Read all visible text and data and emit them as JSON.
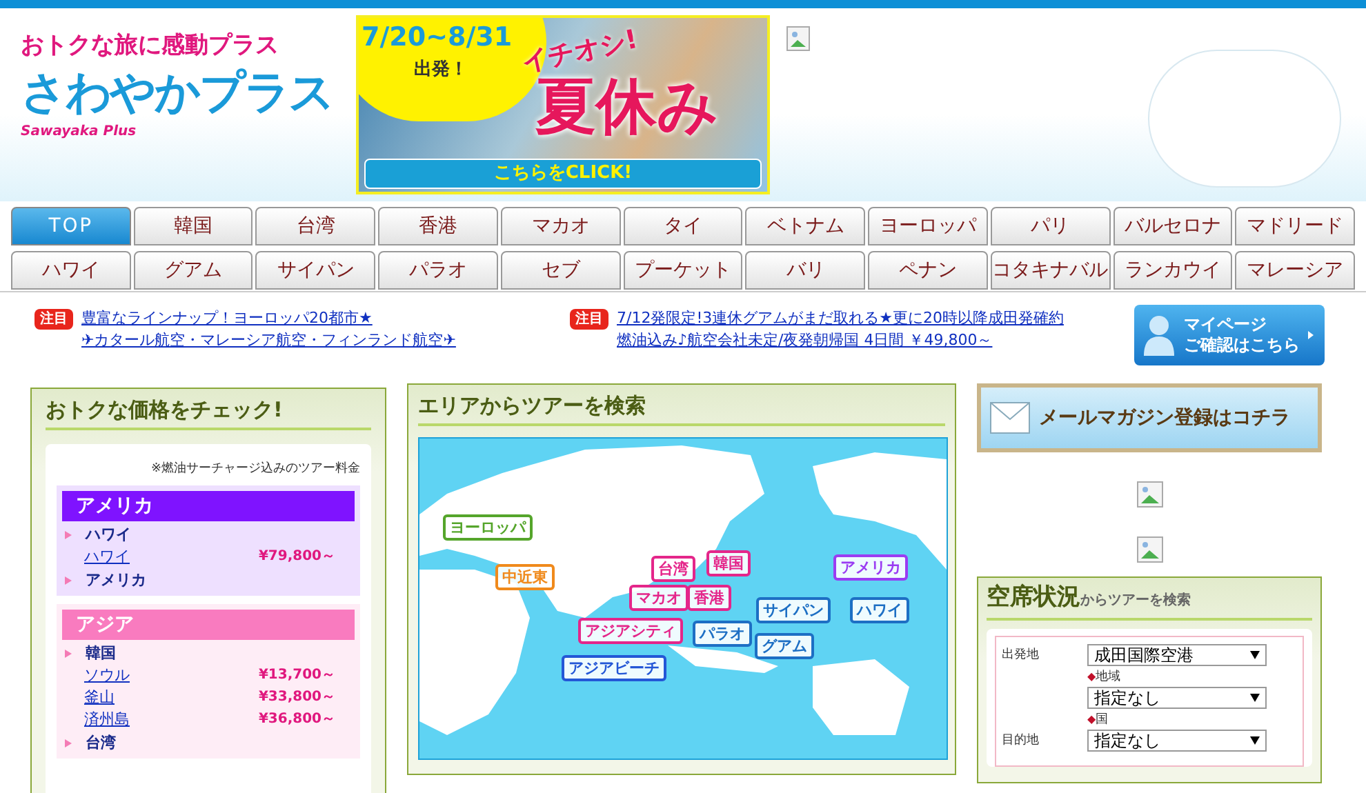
{
  "header": {
    "tagline": "おトクな旅に感動プラス",
    "logo": "さわやかプラス",
    "logo_sub": "Sawayaka Plus",
    "banner": {
      "dates": "7/20~8/31",
      "departure": "出発！",
      "catch": "イチオシ!",
      "title": "夏休み",
      "button": "こちらをCLICK!"
    }
  },
  "tabs": [
    [
      {
        "label": "TOP",
        "selected": true
      },
      {
        "label": "韓国",
        "selected": false
      },
      {
        "label": "台湾",
        "selected": false
      },
      {
        "label": "香港",
        "selected": false
      },
      {
        "label": "マカオ",
        "selected": false
      },
      {
        "label": "タイ",
        "selected": false
      },
      {
        "label": "ベトナム",
        "selected": false
      },
      {
        "label": "ヨーロッパ",
        "selected": false
      },
      {
        "label": "パリ",
        "selected": false
      },
      {
        "label": "バルセロナ",
        "selected": false
      },
      {
        "label": "マドリード",
        "selected": false
      }
    ],
    [
      {
        "label": "ハワイ",
        "selected": false
      },
      {
        "label": "グアム",
        "selected": false
      },
      {
        "label": "サイパン",
        "selected": false
      },
      {
        "label": "パラオ",
        "selected": false
      },
      {
        "label": "セブ",
        "selected": false
      },
      {
        "label": "プーケット",
        "selected": false
      },
      {
        "label": "バリ",
        "selected": false
      },
      {
        "label": "ペナン",
        "selected": false
      },
      {
        "label": "コタキナバル",
        "selected": false
      },
      {
        "label": "ランカウイ",
        "selected": false
      },
      {
        "label": "マレーシア",
        "selected": false
      }
    ]
  ],
  "notices": [
    {
      "badge": "注目",
      "lines": [
        "豊富なラインナップ！ヨーロッパ20都市★",
        "✈カタール航空・マレーシア航空・フィンランド航空✈"
      ]
    },
    {
      "badge": "注目",
      "lines": [
        "7/12発限定!3連休グアムがまだ取れる★更に20時以降成田発確約",
        "燃油込み♪航空会社未定/夜発朝帰国 4日間 ￥49,800～"
      ]
    }
  ],
  "mypage_button": [
    "マイページ",
    "ご確認はこちら"
  ],
  "price_panel": {
    "title": "おトクな価格をチェック!",
    "note": "※燃油サーチャージ込みのツアー料金",
    "regions": [
      {
        "name": "アメリカ",
        "color": "#7f13ff",
        "countries": [
          {
            "name": "ハワイ",
            "cities": [
              {
                "name": "ハワイ",
                "price": "¥79,800～"
              }
            ]
          },
          {
            "name": "アメリカ"
          }
        ]
      },
      {
        "name": "アジア",
        "color": "#f97bbf",
        "countries": [
          {
            "name": "韓国",
            "cities": [
              {
                "name": "ソウル",
                "price": "¥13,700～"
              },
              {
                "name": "釜山",
                "price": "¥33,800～"
              },
              {
                "name": "済州島",
                "price": "¥36,800～"
              }
            ]
          },
          {
            "name": "台湾"
          }
        ]
      }
    ]
  },
  "area_search": {
    "title": "エリアからツアーを検索",
    "labels": [
      {
        "label": "ヨーロッパ",
        "color": "#55a52b"
      },
      {
        "label": "中近東",
        "color": "#f08a1c"
      },
      {
        "label": "台湾",
        "color": "#e4268a"
      },
      {
        "label": "韓国",
        "color": "#e4268a"
      },
      {
        "label": "マカオ",
        "color": "#e4268a"
      },
      {
        "label": "香港",
        "color": "#e4268a"
      },
      {
        "label": "アジアシティ",
        "color": "#e4268a"
      },
      {
        "label": "パラオ",
        "color": "#1d6fc4"
      },
      {
        "label": "サイパン",
        "color": "#1d6fc4"
      },
      {
        "label": "グアム",
        "color": "#1d6fc4"
      },
      {
        "label": "アジアビーチ",
        "color": "#2457d6"
      },
      {
        "label": "アメリカ",
        "color": "#9a3cf2"
      },
      {
        "label": "ハワイ",
        "color": "#1d6fc4"
      }
    ]
  },
  "mail_banner": "メールマガジン登録はコチラ",
  "availability": {
    "title": "空席状況",
    "subtitle": "からツアーを検索",
    "departure_label": "出発地",
    "departure_value": "成田国際空港",
    "region_marker": "◆",
    "region_label": "地域",
    "region_value": "指定なし",
    "destination_label": "目的地",
    "country_marker": "◆",
    "country_label": "国",
    "country_value": "指定なし"
  }
}
